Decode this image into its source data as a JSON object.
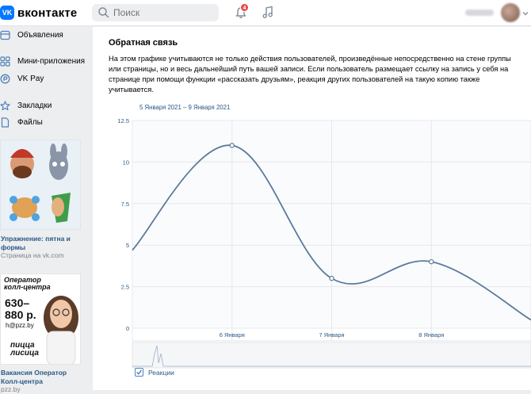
{
  "header": {
    "logo_text": "вконтакте",
    "logo_mark": "VK",
    "search_placeholder": "Поиск",
    "notifications_count": "4"
  },
  "sidebar": {
    "items": [
      {
        "label": "Объявления",
        "icon": "classifieds-icon"
      },
      {
        "label": "Мини-приложения",
        "icon": "mini-apps-icon"
      },
      {
        "label": "VK Pay",
        "icon": "vk-pay-icon"
      },
      {
        "label": "Закладки",
        "icon": "bookmark-star-icon"
      },
      {
        "label": "Файлы",
        "icon": "file-icon"
      }
    ],
    "ads": [
      {
        "title": "Упражнение: пятна и формы",
        "subtitle": "Страница на vk.com"
      },
      {
        "title": "Вакансия Оператор Колл-центра",
        "subtitle": "pzz.by",
        "image_lines": [
          "Оператор",
          "колл-центра",
          "630–",
          "880 р.",
          "h@pzz.by",
          "пицца",
          "лисица"
        ]
      }
    ]
  },
  "main": {
    "title": "Обратная связь",
    "description": "На этом графике учитываются не только действия пользователей, произведённые непосредственно на стене группы или страницы, но и весь дальнейший путь вашей записи. Если пользователь размещает ссылку на запись у себя на странице при помощи функции «рассказать друзьям», реакция других пользователей на такую копию также учитывается.",
    "date_range": "5 Января 2021 – 9 Января 2021",
    "legend_label": "Реакции"
  },
  "chart_data": {
    "type": "line",
    "x": [
      "5 Января",
      "6 Января",
      "7 Января",
      "8 Января",
      "9 Января"
    ],
    "x_tick_labels": [
      "6 Января",
      "7 Января",
      "8 Января"
    ],
    "y_ticks": [
      "0",
      "2.5",
      "5",
      "7.5",
      "10",
      "12.5"
    ],
    "ylim": [
      0,
      12.5
    ],
    "series": [
      {
        "name": "Реакции",
        "values": [
          4.7,
          11,
          3,
          4,
          0.5
        ],
        "color": "#5b7a9c"
      }
    ],
    "grid": true
  }
}
